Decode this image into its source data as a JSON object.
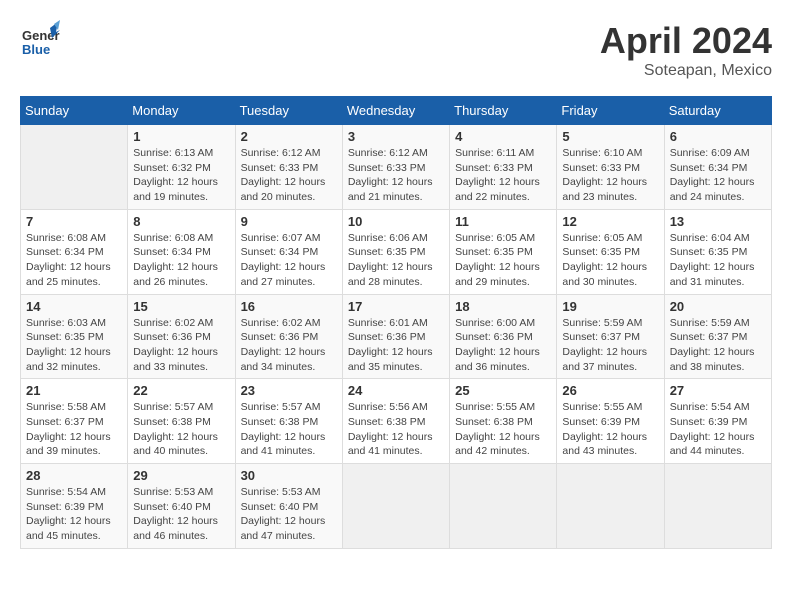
{
  "header": {
    "logo_line1": "General",
    "logo_line2": "Blue",
    "month_year": "April 2024",
    "location": "Soteapan, Mexico"
  },
  "days_of_week": [
    "Sunday",
    "Monday",
    "Tuesday",
    "Wednesday",
    "Thursday",
    "Friday",
    "Saturday"
  ],
  "weeks": [
    [
      {
        "day": "",
        "info": ""
      },
      {
        "day": "1",
        "info": "Sunrise: 6:13 AM\nSunset: 6:32 PM\nDaylight: 12 hours\nand 19 minutes."
      },
      {
        "day": "2",
        "info": "Sunrise: 6:12 AM\nSunset: 6:33 PM\nDaylight: 12 hours\nand 20 minutes."
      },
      {
        "day": "3",
        "info": "Sunrise: 6:12 AM\nSunset: 6:33 PM\nDaylight: 12 hours\nand 21 minutes."
      },
      {
        "day": "4",
        "info": "Sunrise: 6:11 AM\nSunset: 6:33 PM\nDaylight: 12 hours\nand 22 minutes."
      },
      {
        "day": "5",
        "info": "Sunrise: 6:10 AM\nSunset: 6:33 PM\nDaylight: 12 hours\nand 23 minutes."
      },
      {
        "day": "6",
        "info": "Sunrise: 6:09 AM\nSunset: 6:34 PM\nDaylight: 12 hours\nand 24 minutes."
      }
    ],
    [
      {
        "day": "7",
        "info": "Sunrise: 6:08 AM\nSunset: 6:34 PM\nDaylight: 12 hours\nand 25 minutes."
      },
      {
        "day": "8",
        "info": "Sunrise: 6:08 AM\nSunset: 6:34 PM\nDaylight: 12 hours\nand 26 minutes."
      },
      {
        "day": "9",
        "info": "Sunrise: 6:07 AM\nSunset: 6:34 PM\nDaylight: 12 hours\nand 27 minutes."
      },
      {
        "day": "10",
        "info": "Sunrise: 6:06 AM\nSunset: 6:35 PM\nDaylight: 12 hours\nand 28 minutes."
      },
      {
        "day": "11",
        "info": "Sunrise: 6:05 AM\nSunset: 6:35 PM\nDaylight: 12 hours\nand 29 minutes."
      },
      {
        "day": "12",
        "info": "Sunrise: 6:05 AM\nSunset: 6:35 PM\nDaylight: 12 hours\nand 30 minutes."
      },
      {
        "day": "13",
        "info": "Sunrise: 6:04 AM\nSunset: 6:35 PM\nDaylight: 12 hours\nand 31 minutes."
      }
    ],
    [
      {
        "day": "14",
        "info": "Sunrise: 6:03 AM\nSunset: 6:35 PM\nDaylight: 12 hours\nand 32 minutes."
      },
      {
        "day": "15",
        "info": "Sunrise: 6:02 AM\nSunset: 6:36 PM\nDaylight: 12 hours\nand 33 minutes."
      },
      {
        "day": "16",
        "info": "Sunrise: 6:02 AM\nSunset: 6:36 PM\nDaylight: 12 hours\nand 34 minutes."
      },
      {
        "day": "17",
        "info": "Sunrise: 6:01 AM\nSunset: 6:36 PM\nDaylight: 12 hours\nand 35 minutes."
      },
      {
        "day": "18",
        "info": "Sunrise: 6:00 AM\nSunset: 6:36 PM\nDaylight: 12 hours\nand 36 minutes."
      },
      {
        "day": "19",
        "info": "Sunrise: 5:59 AM\nSunset: 6:37 PM\nDaylight: 12 hours\nand 37 minutes."
      },
      {
        "day": "20",
        "info": "Sunrise: 5:59 AM\nSunset: 6:37 PM\nDaylight: 12 hours\nand 38 minutes."
      }
    ],
    [
      {
        "day": "21",
        "info": "Sunrise: 5:58 AM\nSunset: 6:37 PM\nDaylight: 12 hours\nand 39 minutes."
      },
      {
        "day": "22",
        "info": "Sunrise: 5:57 AM\nSunset: 6:38 PM\nDaylight: 12 hours\nand 40 minutes."
      },
      {
        "day": "23",
        "info": "Sunrise: 5:57 AM\nSunset: 6:38 PM\nDaylight: 12 hours\nand 41 minutes."
      },
      {
        "day": "24",
        "info": "Sunrise: 5:56 AM\nSunset: 6:38 PM\nDaylight: 12 hours\nand 41 minutes."
      },
      {
        "day": "25",
        "info": "Sunrise: 5:55 AM\nSunset: 6:38 PM\nDaylight: 12 hours\nand 42 minutes."
      },
      {
        "day": "26",
        "info": "Sunrise: 5:55 AM\nSunset: 6:39 PM\nDaylight: 12 hours\nand 43 minutes."
      },
      {
        "day": "27",
        "info": "Sunrise: 5:54 AM\nSunset: 6:39 PM\nDaylight: 12 hours\nand 44 minutes."
      }
    ],
    [
      {
        "day": "28",
        "info": "Sunrise: 5:54 AM\nSunset: 6:39 PM\nDaylight: 12 hours\nand 45 minutes."
      },
      {
        "day": "29",
        "info": "Sunrise: 5:53 AM\nSunset: 6:40 PM\nDaylight: 12 hours\nand 46 minutes."
      },
      {
        "day": "30",
        "info": "Sunrise: 5:53 AM\nSunset: 6:40 PM\nDaylight: 12 hours\nand 47 minutes."
      },
      {
        "day": "",
        "info": ""
      },
      {
        "day": "",
        "info": ""
      },
      {
        "day": "",
        "info": ""
      },
      {
        "day": "",
        "info": ""
      }
    ]
  ]
}
